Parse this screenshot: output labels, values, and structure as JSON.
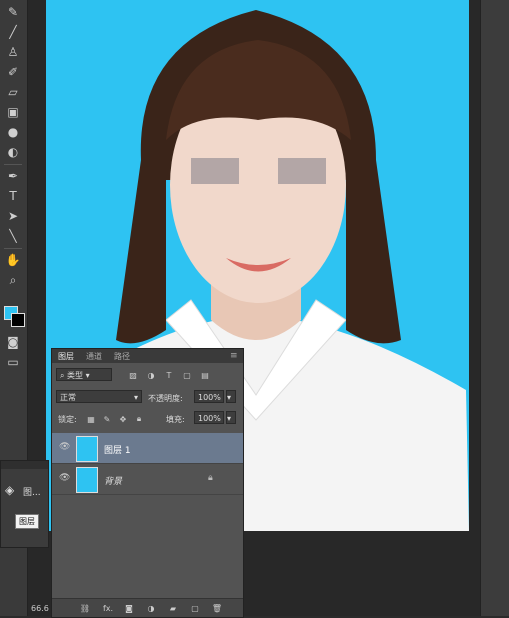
{
  "layers_panel": {
    "tabs": [
      "图层",
      "通道",
      "路径"
    ],
    "filter_kind": "类型",
    "blend_mode": "正常",
    "opacity_label": "不透明度:",
    "opacity_value": "100%",
    "lock_label": "锁定:",
    "fill_label": "填充:",
    "fill_value": "100%",
    "layers": [
      {
        "name": "图层 1",
        "selected": true
      },
      {
        "name": "背景",
        "selected": false,
        "locked": true
      }
    ],
    "footer_icons": [
      "link-icon",
      "fx-icon",
      "mask-icon",
      "adjustment-icon",
      "group-icon",
      "new-layer-icon",
      "trash-icon"
    ],
    "fx_label": "fx."
  },
  "mini_palette": {
    "label": "图..."
  },
  "tooltip": "图层",
  "zoom": "66.6",
  "colors": {
    "canvas_bg": "#2ec3f2",
    "foreground": "#2ec3f2",
    "background": "#000000",
    "selected_layer": "#6b7a8f"
  }
}
